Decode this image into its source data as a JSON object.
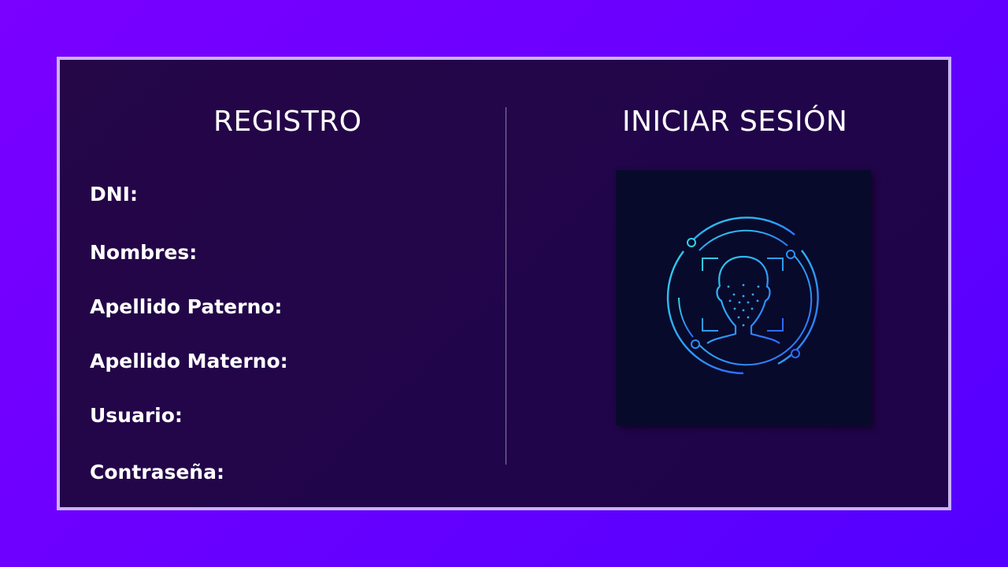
{
  "register": {
    "title": "REGISTRO",
    "fields": [
      {
        "label": "DNI:"
      },
      {
        "label": "Nombres:"
      },
      {
        "label": "Apellido Paterno:"
      },
      {
        "label": "Apellido Materno:"
      },
      {
        "label": "Usuario:"
      },
      {
        "label": "Contraseña:"
      }
    ]
  },
  "login": {
    "title": "INICIAR SESIÓN",
    "icon": "face-recognition-icon"
  },
  "colors": {
    "background_start": "#7a00ff",
    "background_end": "#5300ff",
    "panel": "#22064a",
    "panel_border": "#c9b3f5",
    "text": "#ffffff",
    "icon_cyan": "#2fd3e8",
    "icon_blue": "#2e6bff"
  }
}
